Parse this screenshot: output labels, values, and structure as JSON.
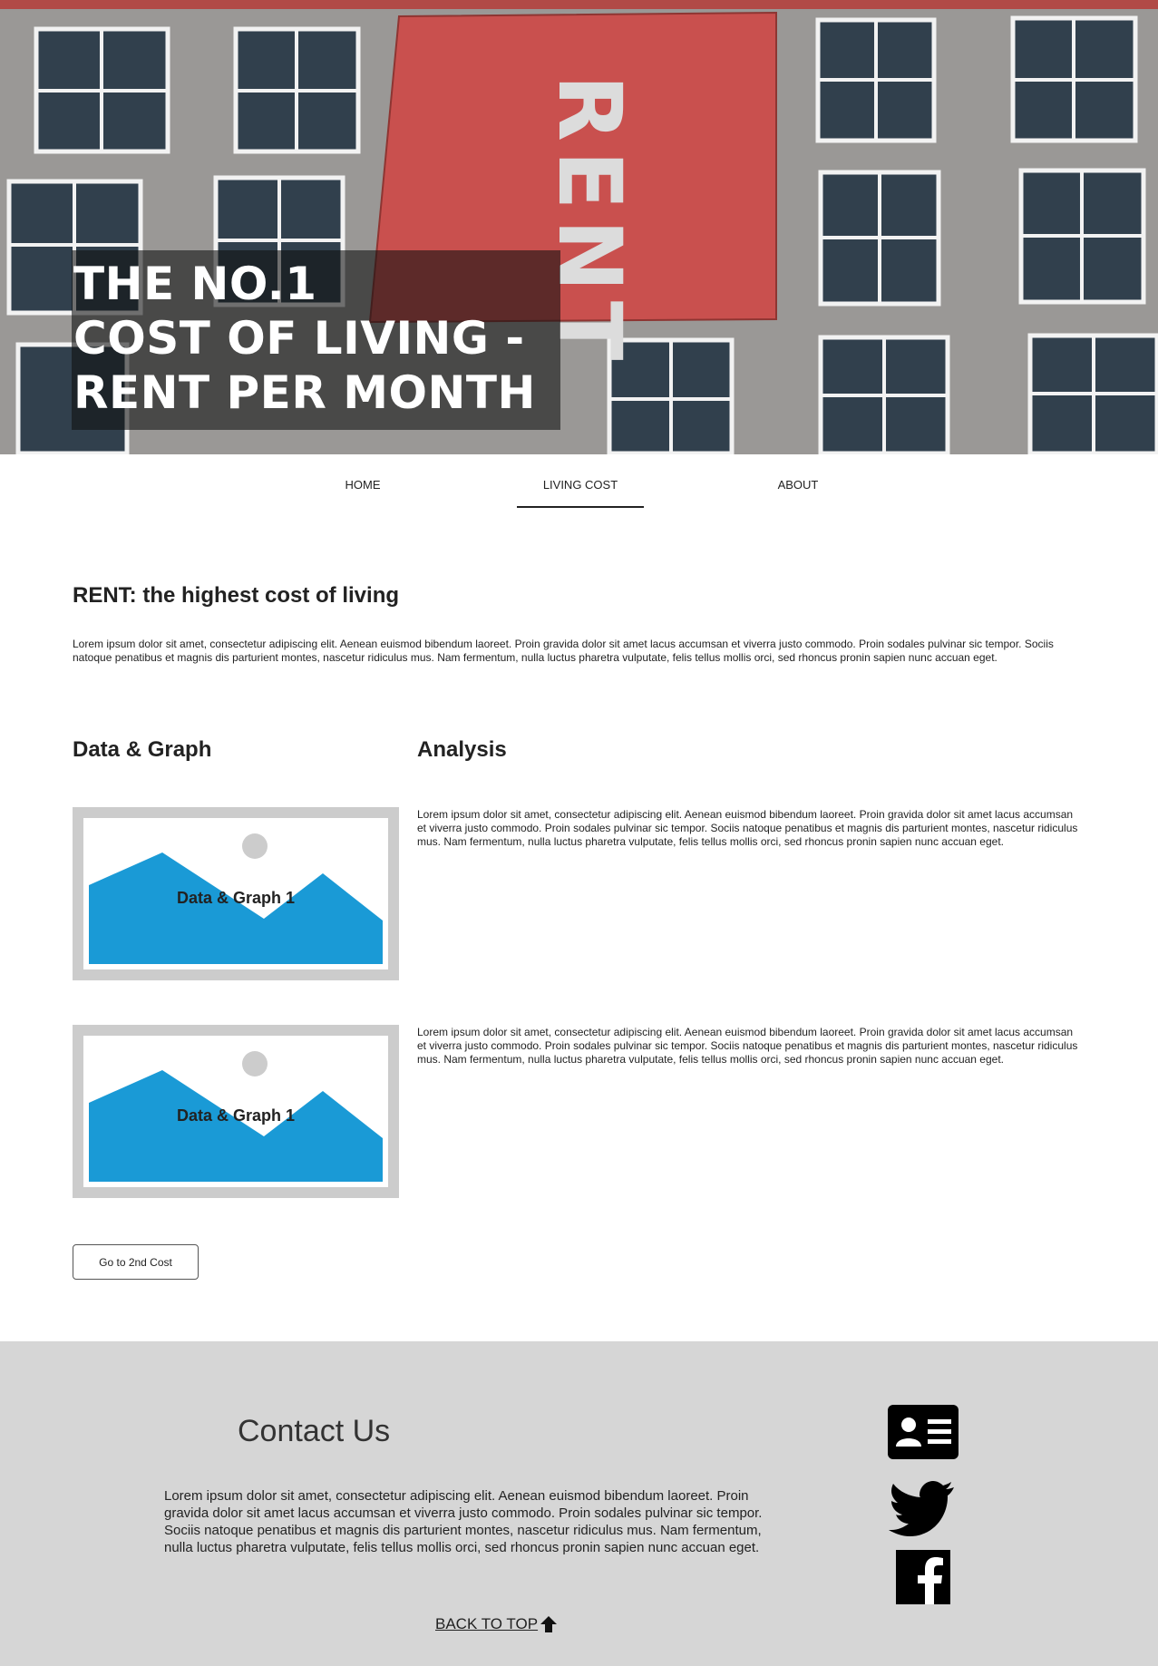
{
  "hero": {
    "banner_text": "RENT",
    "title_lines": [
      "THE NO.1",
      "COST OF LIVING -",
      "RENT PER MONTH"
    ]
  },
  "nav": {
    "items": [
      {
        "label": "HOME",
        "active": false
      },
      {
        "label": "LIVING COST",
        "active": true
      },
      {
        "label": "ABOUT",
        "active": false
      }
    ]
  },
  "intro": {
    "heading": "RENT: the highest cost of living",
    "body": "Lorem ipsum dolor sit amet, consectetur adipiscing elit. Aenean euismod bibendum laoreet. Proin gravida dolor sit amet lacus accumsan et viverra justo commodo. Proin sodales pulvinar sic tempor. Sociis natoque penatibus et magnis dis parturient montes, nascetur ridiculus mus. Nam fermentum, nulla luctus pharetra vulputate, felis tellus mollis orci, sed rhoncus pronin sapien nunc accuan eget."
  },
  "columns": {
    "left_heading": "Data & Graph",
    "right_heading": "Analysis"
  },
  "graphs": [
    {
      "label": "Data & Graph 1",
      "analysis": "Lorem ipsum dolor sit amet, consectetur adipiscing elit. Aenean euismod bibendum laoreet. Proin gravida dolor sit amet lacus accumsan et viverra justo commodo. Proin sodales pulvinar sic tempor. Sociis natoque penatibus et magnis dis parturient montes, nascetur ridiculus mus. Nam fermentum, nulla luctus pharetra vulputate, felis tellus mollis orci, sed rhoncus pronin sapien nunc accuan eget."
    },
    {
      "label": "Data & Graph 1",
      "analysis": "Lorem ipsum dolor sit amet, consectetur adipiscing elit. Aenean euismod bibendum laoreet. Proin gravida dolor sit amet lacus accumsan et viverra justo commodo. Proin sodales pulvinar sic tempor. Sociis natoque penatibus et magnis dis parturient montes, nascetur ridiculus mus. Nam fermentum, nulla luctus pharetra vulputate, felis tellus mollis orci, sed rhoncus pronin sapien nunc accuan eget."
    }
  ],
  "next_button": {
    "label": "Go to 2nd Cost"
  },
  "footer": {
    "contact_title": "Contact Us",
    "body": "Lorem ipsum dolor sit amet, consectetur adipiscing elit. Aenean euismod bibendum laoreet. Proin gravida dolor sit amet lacus accumsan et viverra justo commodo. Proin sodales pulvinar sic tempor. Sociis natoque penatibus et magnis dis parturient montes, nascetur ridiculus mus. Nam fermentum, nulla luctus pharetra vulputate, felis tellus mollis orci, sed rhoncus pronin sapien nunc accuan eget.",
    "back_to_top": "BACK TO TOP",
    "icons": [
      "contact-card-icon",
      "twitter-icon",
      "facebook-icon"
    ]
  },
  "colors": {
    "accent_blue": "#1a9ad6",
    "footer_bg": "#d6d6d6",
    "banner_red": "#c9504e",
    "placeholder_grey": "#cccccc"
  }
}
